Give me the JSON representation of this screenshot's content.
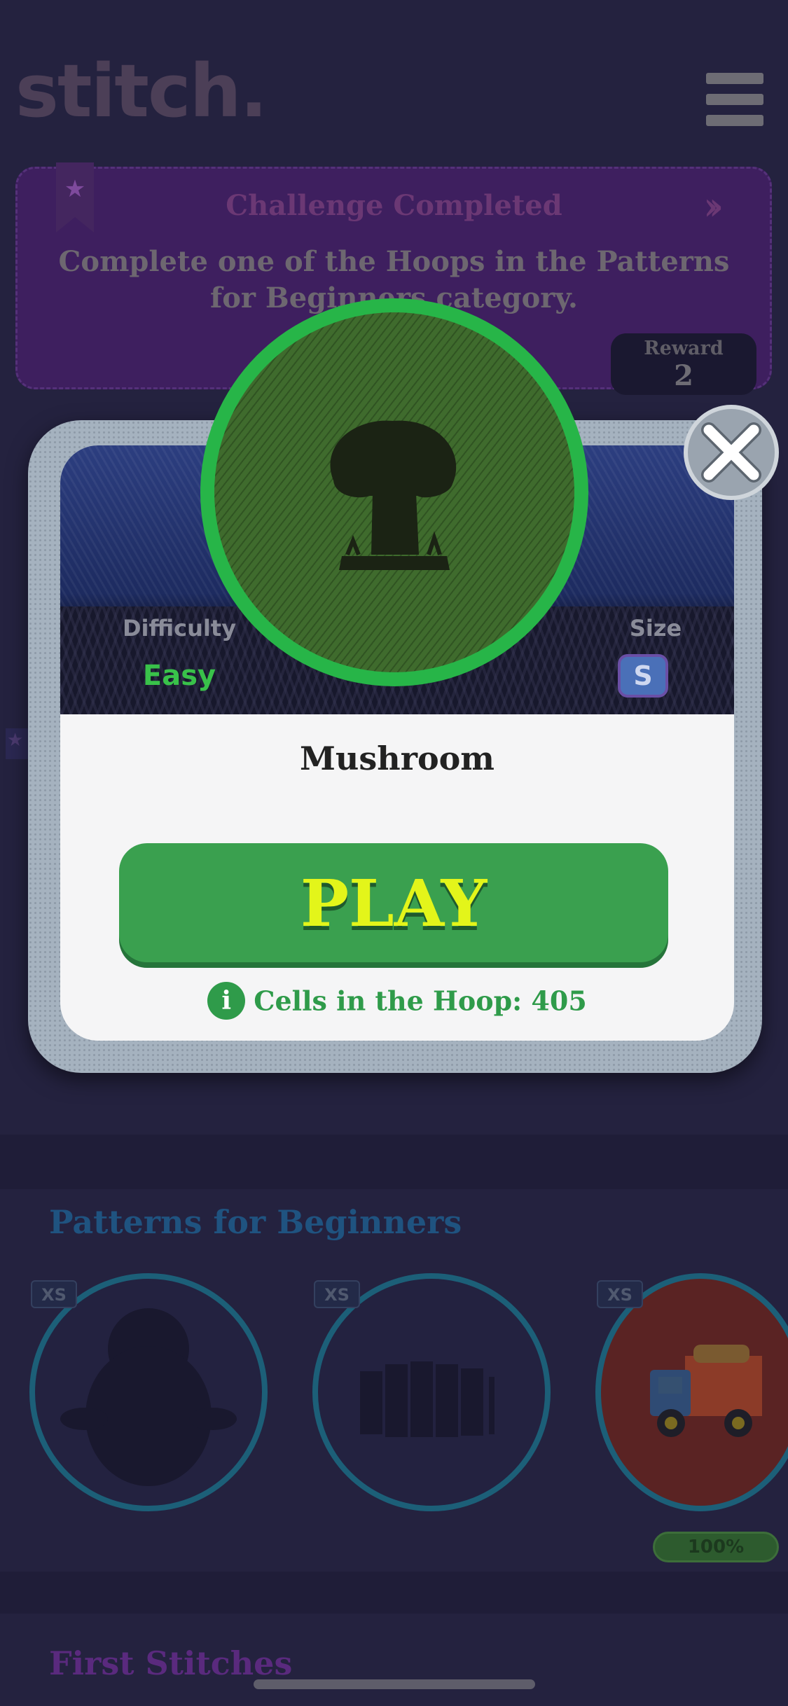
{
  "app": {
    "logo_text": "stitch."
  },
  "challenge": {
    "title": "Challenge Completed",
    "description": "Complete one of the Hoops in the Patterns for Beginners category.",
    "reward_label": "Reward",
    "reward_value": "2"
  },
  "modal": {
    "difficulty_label": "Difficulty",
    "difficulty_value": "Easy",
    "size_label": "Size",
    "size_value": "S",
    "hoop_name": "Mushroom",
    "play_label": "PLAY",
    "cells_label": "Cells in the Hoop: 405",
    "info_icon": "i"
  },
  "sections": [
    {
      "title": "Patterns for Beginners",
      "items": [
        {
          "size": "XS",
          "icon": "penguin-silhouette"
        },
        {
          "size": "XS",
          "icon": "fence-silhouette"
        },
        {
          "size": "XS",
          "icon": "truck",
          "progress": "100%"
        }
      ]
    },
    {
      "title": "First Stitches"
    }
  ],
  "colors": {
    "accent_green": "#3aa04f",
    "play_text": "#e3f51a",
    "challenge_bg": "#3e1f5f"
  }
}
